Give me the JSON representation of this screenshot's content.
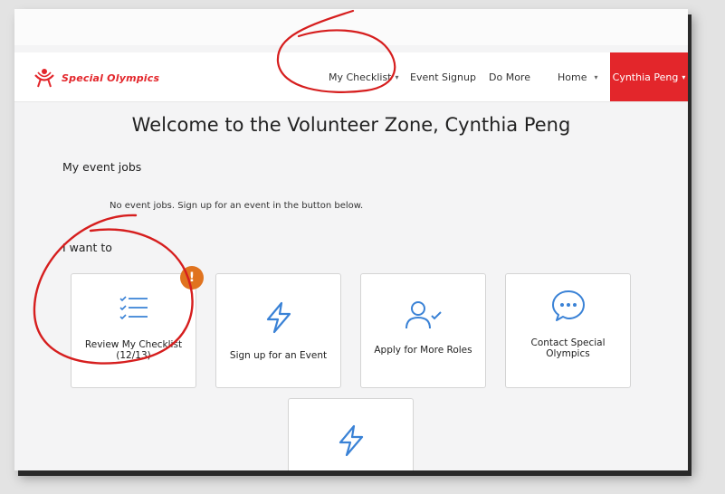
{
  "brand": {
    "name": "Special Olympics",
    "color": "#e3262b"
  },
  "nav": {
    "items": [
      {
        "label": "My Checklist",
        "caret": "▾"
      },
      {
        "label": "Event Signup"
      },
      {
        "label": "Do More"
      },
      {
        "label": "Home",
        "caret": "▾"
      }
    ],
    "user": {
      "label": "Cynthia Peng",
      "caret": "▾"
    }
  },
  "page": {
    "title": "Welcome to the Volunteer Zone, Cynthia Peng",
    "event_jobs": {
      "heading": "My event jobs",
      "empty_text": "No event jobs. Sign up for an event in the button below."
    },
    "i_want_to": {
      "heading": "I want to",
      "cards": [
        {
          "label": "Review My Checklist (12/13)",
          "icon": "checklist-icon",
          "badge": "!"
        },
        {
          "label": "Sign up for an Event",
          "icon": "lightning-icon"
        },
        {
          "label": "Apply for More Roles",
          "icon": "user-check-icon"
        },
        {
          "label": "Contact Special Olympics",
          "icon": "chat-bubble-icon"
        },
        {
          "label": "",
          "icon": "lightning-icon"
        }
      ]
    }
  },
  "colors": {
    "accent_blue": "#3a82d6",
    "badge_orange": "#e0731f",
    "annotation_red": "#d61e1e"
  }
}
